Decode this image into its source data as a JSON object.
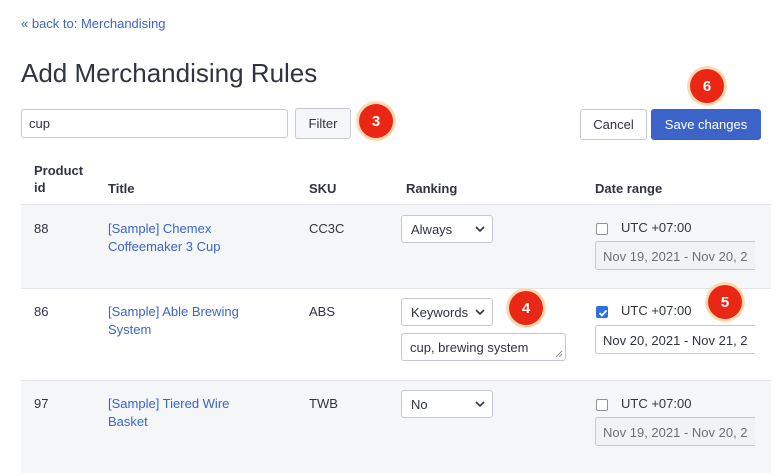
{
  "nav": {
    "back_link": "« back to: Merchandising"
  },
  "page": {
    "title": "Add Merchandising Rules"
  },
  "filter": {
    "value": "cup",
    "button_label": "Filter"
  },
  "actions": {
    "cancel_label": "Cancel",
    "save_label": "Save changes"
  },
  "markers": [
    "3",
    "4",
    "5",
    "6"
  ],
  "table": {
    "columns": {
      "product_id": "Product id",
      "title": "Title",
      "sku": "SKU",
      "ranking": "Ranking",
      "date_range": "Date range"
    },
    "rows": [
      {
        "id": "88",
        "title": "[Sample] Chemex Coffeemaker 3 Cup",
        "sku": "CC3C",
        "ranking": "Always",
        "keywords": "",
        "date_enabled": false,
        "timezone": "UTC +07:00",
        "date_range": "Nov 19, 2021 - Nov 20, 2"
      },
      {
        "id": "86",
        "title": "[Sample] Able Brewing System",
        "sku": "ABS",
        "ranking": "Keywords",
        "keywords": "cup, brewing system",
        "date_enabled": true,
        "timezone": "UTC +07:00",
        "date_range": "Nov 20, 2021 - Nov 21, 2"
      },
      {
        "id": "97",
        "title": "[Sample] Tiered Wire Basket",
        "sku": "TWB",
        "ranking": "No",
        "keywords": "",
        "date_enabled": false,
        "timezone": "UTC +07:00",
        "date_range": "Nov 19, 2021 - Nov 20, 2"
      }
    ]
  },
  "colors": {
    "accent": "#3c64c8",
    "marker": "#ea2715",
    "checkbox_checked": "#2f6fde"
  }
}
